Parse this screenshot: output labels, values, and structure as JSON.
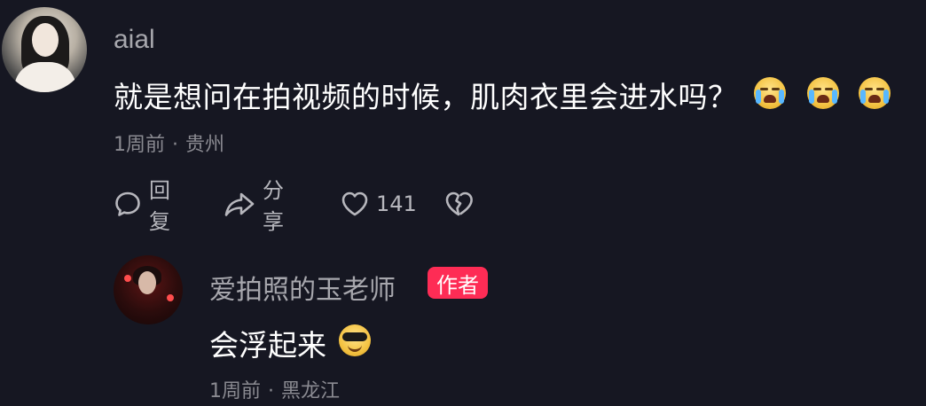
{
  "main_comment": {
    "username": "aial",
    "text": "就是想问在拍视频的时候，肌肉衣里会进水吗？",
    "emojis": [
      "loudly-crying-face",
      "loudly-crying-face",
      "loudly-crying-face"
    ],
    "time": "1周前",
    "separator": "·",
    "location": "贵州",
    "actions": {
      "reply_label": "回复",
      "share_label": "分享",
      "like_count": "141"
    }
  },
  "reply": {
    "username": "爱拍照的玉老师",
    "badge": "作者",
    "text": "会浮起来",
    "emoji": "smiling-face-with-sunglasses",
    "time": "1周前",
    "separator": "·",
    "location": "黑龙江"
  },
  "colors": {
    "background": "#161722",
    "username": "#a7a7ad",
    "meta": "#8a8a91",
    "badge": "#fe2c55"
  }
}
